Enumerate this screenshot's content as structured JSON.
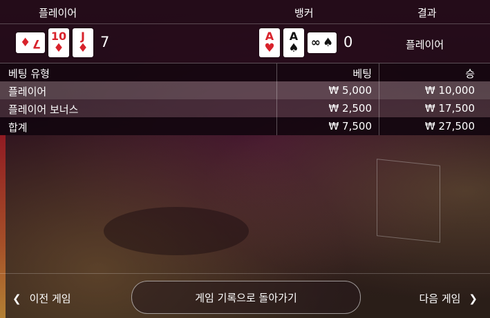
{
  "header": {
    "player": "플레이어",
    "banker": "뱅커",
    "result": "결과"
  },
  "player_hand": {
    "cards": [
      {
        "rank": "7",
        "suit": "♦",
        "color": "#d8222b",
        "orientation": "sideways"
      },
      {
        "rank": "10",
        "suit": "♦",
        "color": "#d8222b",
        "orientation": "upright"
      },
      {
        "rank": "J",
        "suit": "♦",
        "color": "#d8222b",
        "orientation": "upright"
      }
    ],
    "total": "7"
  },
  "banker_hand": {
    "cards": [
      {
        "rank": "A",
        "suit": "♥",
        "color": "#d8222b",
        "orientation": "upright"
      },
      {
        "rank": "A",
        "suit": "♠",
        "color": "#111111",
        "orientation": "upright"
      },
      {
        "rank": "∞",
        "suit": "♠",
        "color": "#111111",
        "orientation": "sideways"
      }
    ],
    "total": "0"
  },
  "result_value": "플레이어",
  "bet_table": {
    "headers": {
      "type": "베팅 유형",
      "bet": "베팅",
      "win": "승"
    },
    "rows": [
      {
        "type": "플레이어",
        "bet": "₩ 5,000",
        "win": "₩ 10,000"
      },
      {
        "type": "플레이어 보너스",
        "bet": "₩ 2,500",
        "win": "₩ 17,500"
      },
      {
        "type": "합계",
        "bet": "₩ 7,500",
        "win": "₩ 27,500"
      }
    ]
  },
  "nav": {
    "prev": "이전 게임",
    "back": "게임 기록으로 돌아가기",
    "next": "다음 게임",
    "prev_icon": "chevron-left-icon",
    "next_icon": "chevron-right-icon"
  }
}
